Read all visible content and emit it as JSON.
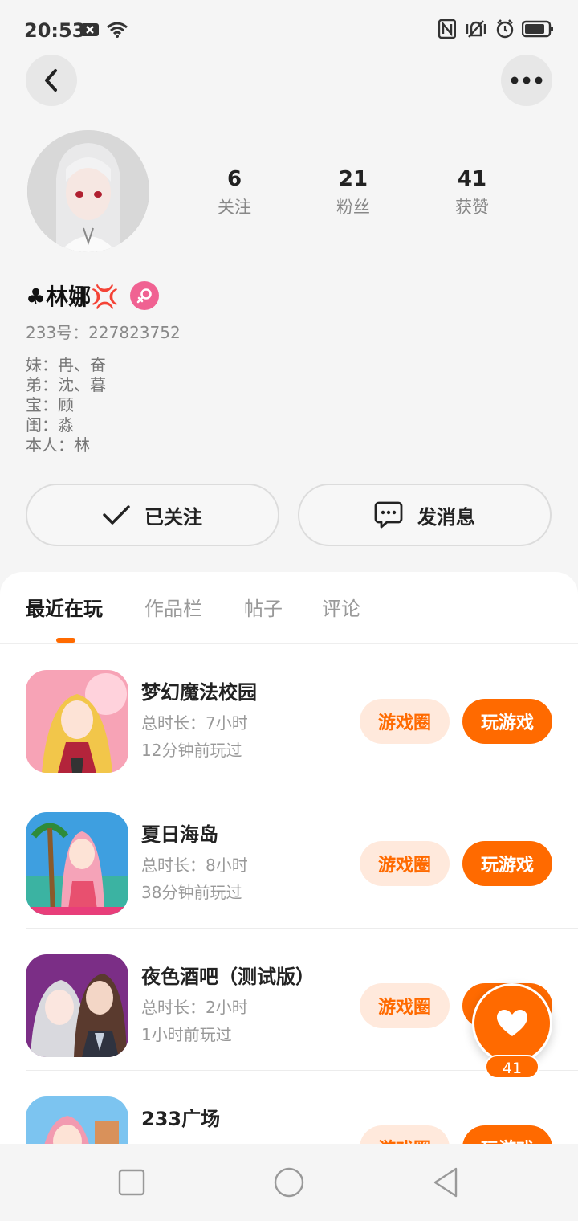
{
  "status_bar": {
    "time": "20:53"
  },
  "profile": {
    "name": "♣林娜💢",
    "uid": "233号：227823752",
    "bio": [
      "妹：冉、奋",
      "弟：沈、暮",
      "宝：顾",
      "闺：淼",
      "本人：林"
    ],
    "stats": [
      {
        "value": "6",
        "label": "关注"
      },
      {
        "value": "21",
        "label": "粉丝"
      },
      {
        "value": "41",
        "label": "获赞"
      }
    ],
    "gender_color": "#f06292"
  },
  "actions": {
    "follow": "已关注",
    "message": "发消息"
  },
  "tabs": [
    "最近在玩",
    "作品栏",
    "帖子",
    "评论"
  ],
  "games": [
    {
      "title": "梦幻魔法校园",
      "duration": "总时长：7小时",
      "last_played": "12分钟前玩过",
      "circle": "游戏圈",
      "play": "玩游戏"
    },
    {
      "title": "夏日海岛",
      "duration": "总时长：8小时",
      "last_played": "38分钟前玩过",
      "circle": "游戏圈",
      "play": "玩游戏"
    },
    {
      "title": "夜色酒吧（测试版）",
      "duration": "总时长：2小时",
      "last_played": "1小时前玩过",
      "circle": "游戏圈",
      "play": "玩游戏"
    },
    {
      "title": "233广场",
      "duration": "",
      "last_played": "",
      "circle": "游戏圈",
      "play": "玩游戏"
    }
  ],
  "like": {
    "count": "41"
  },
  "colors": {
    "accent": "#ff6a00",
    "accent_light": "#ffe9dc"
  }
}
